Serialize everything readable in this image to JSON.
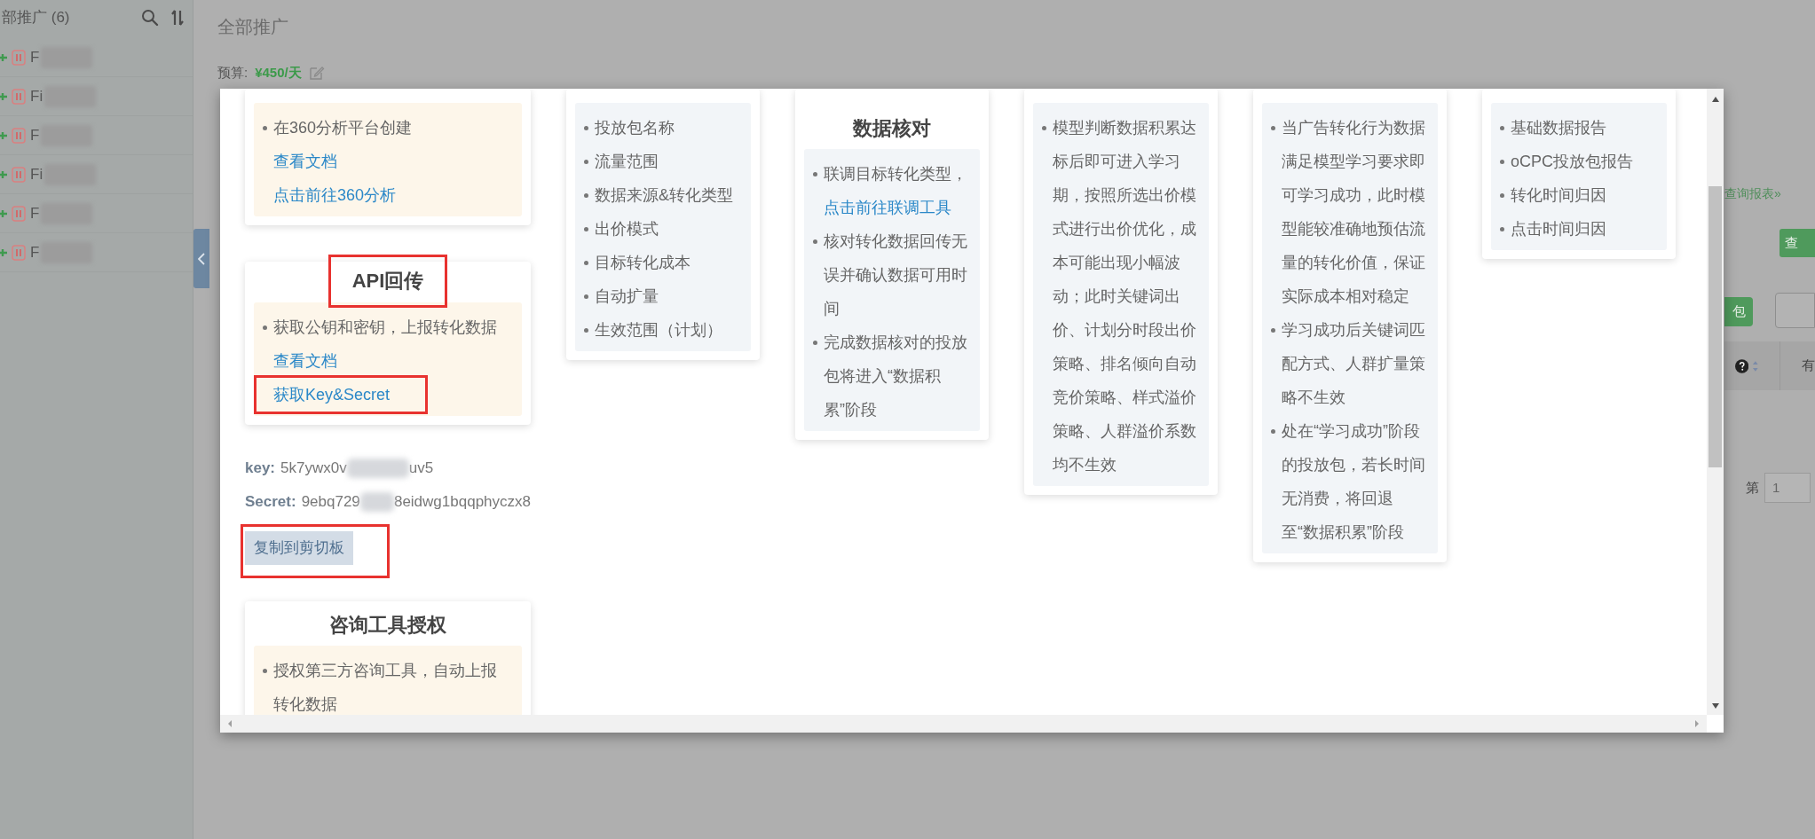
{
  "sidebar": {
    "header": "部推广 (6)",
    "items": [
      {
        "label": "F"
      },
      {
        "label": "Fi"
      },
      {
        "label": "F"
      },
      {
        "label": "Fi"
      },
      {
        "label": "F"
      },
      {
        "label": "F"
      }
    ]
  },
  "main": {
    "title": "全部推广",
    "budget_label": "预算:",
    "budget_value": "¥450/天"
  },
  "background": {
    "report_link": "查询报表»",
    "query_button": "查",
    "package_button": "包",
    "table_header_cell": "有",
    "pagination_label": "第",
    "page_input": "1"
  },
  "modal": {
    "columns": [
      {
        "blocks": [
          {
            "kind": "card",
            "items": [
              {
                "kind": "bullet",
                "text": "在360分析平台创建",
                "highlighted": false
              },
              {
                "kind": "link",
                "text": "查看文档",
                "highlighted": false
              },
              {
                "kind": "link",
                "text": "点击前往360分析",
                "highlighted": false
              }
            ]
          },
          {
            "kind": "card",
            "title": "API回传",
            "title_highlighted": true,
            "items": [
              {
                "kind": "bullet",
                "text": "获取公钥和密钥，上报转化数据",
                "highlighted": false
              },
              {
                "kind": "link",
                "text": "查看文档",
                "highlighted": false
              },
              {
                "kind": "link",
                "text": "获取Key&Secret",
                "highlighted": true
              }
            ]
          },
          {
            "kind": "credentials",
            "rows": [
              {
                "label": "key:",
                "parts": [
                  "5k7ywx0v",
                  "uv5"
                ]
              },
              {
                "label": "Secret:",
                "parts": [
                  "9ebq729",
                  "8eidwg1bqqphyczx8"
                ]
              }
            ]
          },
          {
            "kind": "button",
            "label": "复制到剪切板",
            "highlighted": true
          },
          {
            "kind": "card",
            "title": "咨询工具授权",
            "title_highlighted": false,
            "items": [
              {
                "kind": "bullet",
                "text": "授权第三方咨询工具，自动上报转化数据",
                "highlighted": false
              }
            ]
          }
        ]
      },
      {
        "blocks": [
          {
            "kind": "card",
            "items": [
              {
                "kind": "bullet",
                "text": "投放包名称",
                "highlighted": false
              },
              {
                "kind": "bullet",
                "text": "流量范围",
                "highlighted": false
              },
              {
                "kind": "bullet",
                "text": "数据来源&转化类型",
                "highlighted": false
              },
              {
                "kind": "bullet",
                "text": "出价模式",
                "highlighted": false
              },
              {
                "kind": "bullet",
                "text": "目标转化成本",
                "highlighted": false
              },
              {
                "kind": "bullet",
                "text": "自动扩量",
                "highlighted": false
              },
              {
                "kind": "bullet",
                "text": "生效范围（计划）",
                "highlighted": false
              }
            ]
          }
        ]
      },
      {
        "blocks": [
          {
            "kind": "card",
            "title": "数据核对",
            "title_highlighted": false,
            "items": [
              {
                "kind": "bullet",
                "text": "联调目标转化类型，",
                "highlighted": false
              },
              {
                "kind": "link",
                "text": "点击前往联调工具",
                "highlighted": false
              },
              {
                "kind": "bullet",
                "text": "核对转化数据回传无误并确认数据可用时间",
                "highlighted": false
              },
              {
                "kind": "bullet",
                "text": "完成数据核对的投放包将进入“数据积累”阶段",
                "highlighted": false
              }
            ]
          }
        ]
      },
      {
        "blocks": [
          {
            "kind": "card",
            "items": [
              {
                "kind": "bullet",
                "text": "模型判断数据积累达标后即可进入学习期，按照所选出价模式进行出价优化，成本可能出现小幅波动；此时关键词出价、计划分时段出价策略、排名倾向自动竞价策略、样式溢价策略、人群溢价系数均不生效",
                "highlighted": false
              }
            ]
          }
        ]
      },
      {
        "blocks": [
          {
            "kind": "card",
            "items": [
              {
                "kind": "bullet",
                "text": "当广告转化行为数据满足模型学习要求即可学习成功，此时模型能较准确地预估流量的转化价值，保证实际成本相对稳定",
                "highlighted": false
              },
              {
                "kind": "bullet",
                "text": "学习成功后关键词匹配方式、人群扩量策略不生效",
                "highlighted": false
              },
              {
                "kind": "bullet",
                "text": "处在“学习成功”阶段的投放包，若长时间无消费，将回退至“数据积累”阶段",
                "highlighted": false
              }
            ]
          }
        ]
      },
      {
        "blocks": [
          {
            "kind": "card",
            "items": [
              {
                "kind": "bullet",
                "text": "基础数据报告",
                "highlighted": false
              },
              {
                "kind": "bullet",
                "text": "oCPC投放包报告",
                "highlighted": false
              },
              {
                "kind": "bullet",
                "text": "转化时间归因",
                "highlighted": false
              },
              {
                "kind": "bullet",
                "text": "点击时间归因",
                "highlighted": false
              }
            ]
          }
        ]
      }
    ]
  }
}
